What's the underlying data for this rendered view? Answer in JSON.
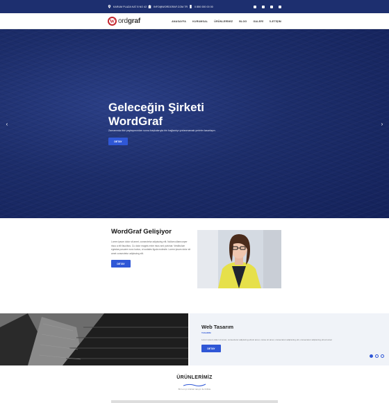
{
  "topbar": {
    "address": "KARUM PLAZA KAT 8 NO 42",
    "email": "INFO@WORDGRAF.COM.TR",
    "phone": "0 850 000 00 00",
    "social": [
      "facebook-icon",
      "instagram-icon",
      "twitter-icon",
      "youtube-icon"
    ],
    "bg_color": "#1d2f6f"
  },
  "header": {
    "logo_mark": "W",
    "logo_text_a": "ord",
    "logo_text_b": "graf",
    "nav": [
      "ANASAYFA",
      "KURUMSAL",
      "ÜRÜNLERİMİZ",
      "BLOG",
      "GALERİ",
      "İLETİŞİM"
    ]
  },
  "hero": {
    "title_line1": "Geleceğin Şirketi",
    "title_line2": "WordGraf",
    "subtitle": "Zamanında fikir paylaşımından sonra başkalarıyla bin bağlantıyı yorlanmamak yerleler tasarlaşın.",
    "button": "DETAY",
    "accent": "#2f57d6"
  },
  "about": {
    "title": "WordGraf Gelişiyor",
    "text": "Lorem ipsum dolor sit amet, consectetur adipiscing elit. Nullam ullamcorper risus a elit faucibus. Cu dolor magnis enim risus sed pulvinar. Vestibulum egestas posuere nunc luctus, ut sodales ligula molestie. Lorem ipsum dolor sit amet consectetur adipiscing elit.",
    "button": "DETAY"
  },
  "service": {
    "title": "Web Tasarım",
    "category": "TASARIM",
    "text": "Lorem ipsum dolor sit amet, consectetur adipiscing elit,sit amet, conse sit amet, consectetur adipiscing elit, consectetur adipiscing elit,sit amet",
    "button": "DETAY",
    "dots": 3,
    "active_dot": 1
  },
  "products": {
    "title": "ÜRÜNLERİMİZ",
    "subtitle": "Bizi en iyi ürünleri tanıyın ile birlikte"
  }
}
